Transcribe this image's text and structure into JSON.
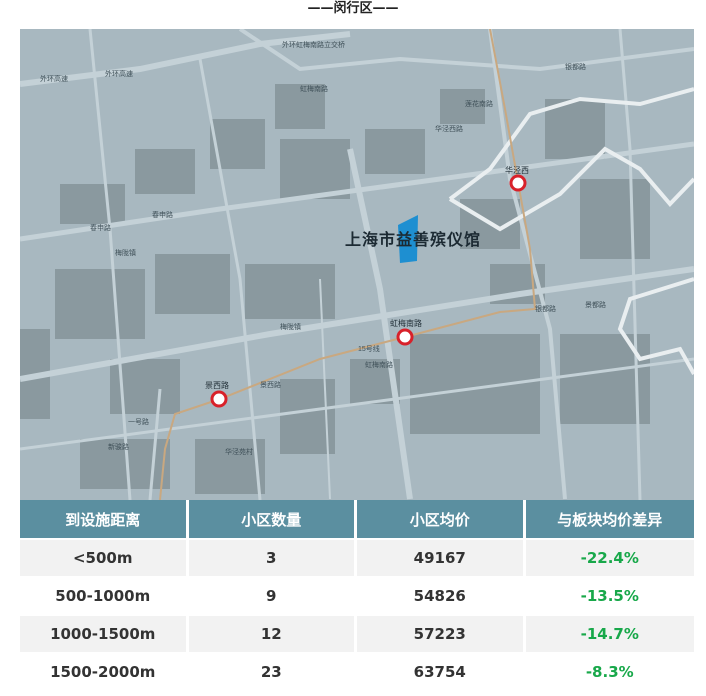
{
  "page": {
    "title": "——闵行区——"
  },
  "map": {
    "poi": {
      "name": "上海市益善殡仪馆",
      "color": "#1e8fd1"
    },
    "stations": [
      {
        "name": "华泾西"
      },
      {
        "name": "虹梅南路"
      },
      {
        "name": "景西路"
      }
    ],
    "road_labels": [
      "外环高速",
      "外环高速",
      "外环虹梅南路立交桥",
      "虹梅南路",
      "春申路",
      "春申路",
      "莲花南路",
      "华泾西路",
      "银都路",
      "梅陇镇",
      "景西路",
      "15号线",
      "虹梅南路",
      "一号路",
      "新骏路",
      "华泾苑村",
      "银都路",
      "景都路",
      "梅陇镇"
    ],
    "colors": {
      "background": "#a8b8c0",
      "block": "#8a999f",
      "road": "#c4d1d7",
      "boundary": "#ffffff",
      "metro": "#c9a880",
      "station": "#d8212a"
    }
  },
  "table": {
    "headers": [
      "到设施距离",
      "小区数量",
      "小区均价",
      "与板块均价差异"
    ],
    "rows": [
      {
        "distance": "<500m",
        "count": "3",
        "price": "49167",
        "diff": "-22.4%"
      },
      {
        "distance": "500-1000m",
        "count": "9",
        "price": "54826",
        "diff": "-13.5%"
      },
      {
        "distance": "1000-1500m",
        "count": "12",
        "price": "57223",
        "diff": "-14.7%"
      },
      {
        "distance": "1500-2000m",
        "count": "23",
        "price": "63754",
        "diff": "-8.3%"
      }
    ],
    "colors": {
      "header_bg": "#5b8fa0",
      "diff_text": "#18a84a"
    }
  }
}
